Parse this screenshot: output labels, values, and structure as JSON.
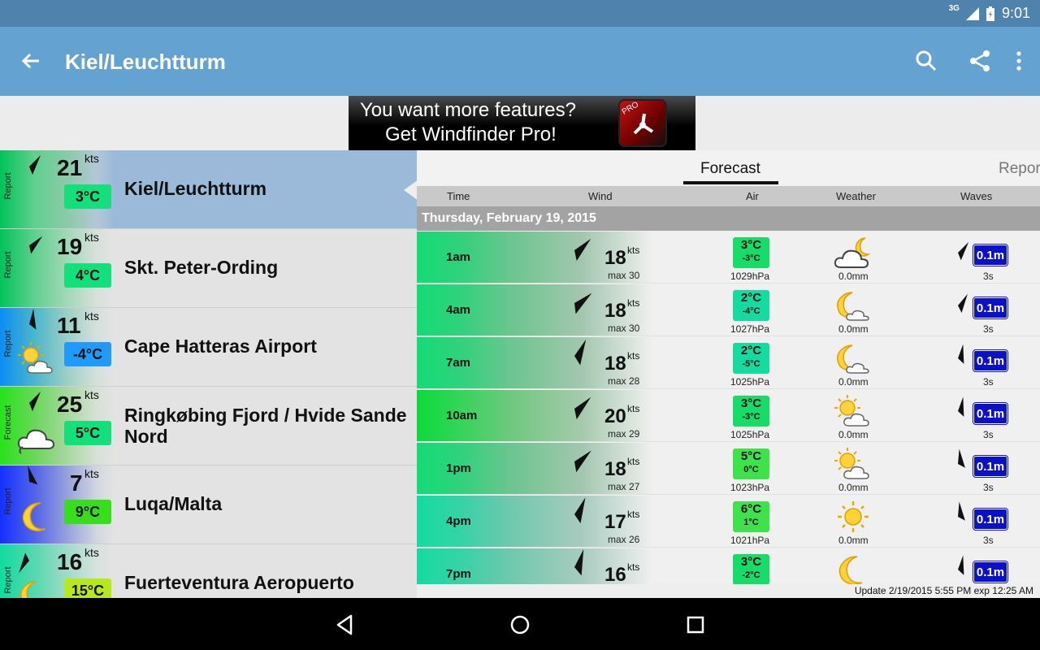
{
  "statusbar": {
    "network": "3G",
    "time": "9:01"
  },
  "appbar": {
    "title": "Kiel/Leuchtturm"
  },
  "ad": {
    "line1": "You want more features?",
    "line2": "Get Windfinder Pro!",
    "badge": "PRO"
  },
  "favorites": [
    {
      "type": "Report",
      "speed": "21",
      "unit": "kts",
      "temp": "3°C",
      "temp_color": "#12e07a",
      "name": "Kiel/Leuchtturm",
      "grad": "linear-gradient(90deg,#00c35a,#5fd08e 30%,#8ec9aa 60%,#b3c8d8 85%,#9bbad9)",
      "weather_icon": null,
      "selected": true
    },
    {
      "type": "Report",
      "speed": "19",
      "unit": "kts",
      "temp": "4°C",
      "temp_color": "#12e07a",
      "name": "Skt. Peter-Ording",
      "grad": "linear-gradient(90deg,#00c35a,#5fd08e 30%,#a4d8b9 60%,#d8e0db 85%,#e3e3e3)",
      "weather_icon": null,
      "selected": false
    },
    {
      "type": "Report",
      "speed": "11",
      "unit": "kts",
      "temp": "-4°C",
      "temp_color": "#1e9bff",
      "name": "Cape Hatteras Airport",
      "grad": "linear-gradient(90deg,#0c8df4,#4ab6cc 30%,#9fd0c6 60%,#d5e0dc 85%,#e3e3e3)",
      "weather_icon": "sun-cloud-icon",
      "selected": false
    },
    {
      "type": "Forecast",
      "speed": "25",
      "unit": "kts",
      "temp": "5°C",
      "temp_color": "#12e07a",
      "name": "Ringkøbing Fjord / Hvide Sande Nord",
      "grad": "linear-gradient(90deg,#27e21a,#68d858 30%,#a9d8a1 60%,#d7e1d5 85%,#e3e3e3)",
      "weather_icon": "cloud-icon",
      "selected": false
    },
    {
      "type": "Report",
      "speed": "7",
      "unit": "kts",
      "temp": "9°C",
      "temp_color": "#35e01a",
      "name": "Luqa/Malta",
      "grad": "linear-gradient(90deg,#1330ff,#5263e8 30%,#9aa3dc 60%,#d3d6e0 85%,#e3e3e3)",
      "weather_icon": "moon-icon",
      "selected": false
    },
    {
      "type": "Report",
      "speed": "16",
      "unit": "kts",
      "temp": "15°C",
      "temp_color": "#b6e81a",
      "name": "Fuerteventura Aeropuerto",
      "grad": "linear-gradient(90deg,#0fdc9d,#55d8af 30%,#a1dcc9 60%,#d7e2de 85%,#e3e3e3)",
      "weather_icon": "moon-cloud-icon",
      "selected": false
    }
  ],
  "tabs": {
    "forecast": "Forecast",
    "report": "Repor"
  },
  "columns": {
    "time": "Time",
    "wind": "Wind",
    "air": "Air",
    "weather": "Weather",
    "waves": "Waves"
  },
  "day": "Thursday, February 19, 2015",
  "forecast": [
    {
      "time": "1am",
      "speed": "18",
      "unit": "kts",
      "max": "max 30",
      "temp": "3°C",
      "temp2": "-3°C",
      "air_color": "#16dc6a",
      "hpa": "1029hPa",
      "weather_icon": "cloud-moon-icon",
      "rain": "0.0mm",
      "wave": "0.1m",
      "period": "3s",
      "band": "linear-gradient(90deg,#12dc74 0,#2fd27c 18%,#6cc58f 40%,#a3c6af 70%,#f0f0f0 100%)"
    },
    {
      "time": "4am",
      "speed": "18",
      "unit": "kts",
      "max": "max 30",
      "temp": "2°C",
      "temp2": "-4°C",
      "air_color": "#14dca0",
      "hpa": "1027hPa",
      "weather_icon": "moon-cloud-icon",
      "rain": "0.0mm",
      "wave": "0.1m",
      "period": "3s",
      "band": "linear-gradient(90deg,#12dc74 0,#2fd27c 18%,#6cc58f 40%,#a3c6af 70%,#f0f0f0 100%)"
    },
    {
      "time": "7am",
      "speed": "18",
      "unit": "kts",
      "max": "max 28",
      "temp": "2°C",
      "temp2": "-5°C",
      "air_color": "#14dca0",
      "hpa": "1025hPa",
      "weather_icon": "moon-cloud-icon",
      "rain": "0.0mm",
      "wave": "0.1m",
      "period": "3s",
      "band": "linear-gradient(90deg,#12dc74 0,#2fd27c 18%,#6cc58f 40%,#a3c6af 70%,#f0f0f0 100%)"
    },
    {
      "time": "10am",
      "speed": "20",
      "unit": "kts",
      "max": "max 29",
      "temp": "3°C",
      "temp2": "-3°C",
      "air_color": "#16dc6a",
      "hpa": "1025hPa",
      "weather_icon": "sun-cloud-icon",
      "rain": "0.0mm",
      "wave": "0.1m",
      "period": "3s",
      "band": "linear-gradient(90deg,#0bdb3a 0,#34d459 18%,#6fc87f 40%,#a6c9ad 70%,#f0f0f0 100%)"
    },
    {
      "time": "1pm",
      "speed": "18",
      "unit": "kts",
      "max": "max 27",
      "temp": "5°C",
      "temp2": "0°C",
      "air_color": "#3ee24a",
      "hpa": "1023hPa",
      "weather_icon": "sun-cloud-icon",
      "rain": "0.0mm",
      "wave": "0.1m",
      "period": "3s",
      "band": "linear-gradient(90deg,#12dc74 0,#2fd27c 18%,#6cc58f 40%,#a3c6af 70%,#f0f0f0 100%)"
    },
    {
      "time": "4pm",
      "speed": "17",
      "unit": "kts",
      "max": "max 26",
      "temp": "6°C",
      "temp2": "1°C",
      "air_color": "#3ee24a",
      "hpa": "1021hPa",
      "weather_icon": "sun-icon",
      "rain": "0.0mm",
      "wave": "0.1m",
      "period": "3s",
      "band": "linear-gradient(90deg,#12dca0 0,#34d3a6 18%,#70c8ad 40%,#a8cbbf 70%,#f0f0f0 100%)"
    },
    {
      "time": "7pm",
      "speed": "16",
      "unit": "kts",
      "max": "",
      "temp": "3°C",
      "temp2": "-2°C",
      "air_color": "#16dc6a",
      "hpa": "",
      "weather_icon": "moon-icon",
      "rain": "",
      "wave": "0.1m",
      "period": "",
      "band": "linear-gradient(90deg,#12dca0 0,#34d3a6 18%,#70c8ad 40%,#a8cbbf 70%,#f0f0f0 100%)"
    }
  ],
  "update": "Update 2/19/2015 5:55 PM exp 12:25 AM"
}
